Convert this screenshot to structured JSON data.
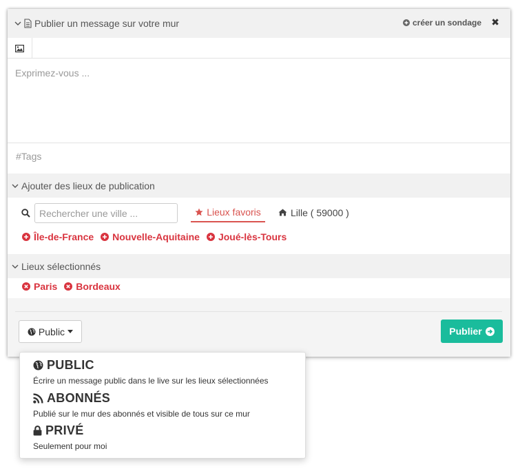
{
  "header": {
    "title": "Publier un message sur votre mur",
    "create_poll": "créer un sondage",
    "close": "✖"
  },
  "editor": {
    "placeholder": "Exprimez-vous ...",
    "tags_placeholder": "#Tags"
  },
  "places": {
    "section_title": "Ajouter des lieux de publication",
    "search_placeholder": "Rechercher une ville ...",
    "tab_favorites": "Lieux favoris",
    "tab_home": "Lille ( 59000 )",
    "suggestions": [
      "Île-de-France",
      "Nouvelle-Aquitaine",
      "Joué-lès-Tours"
    ]
  },
  "selected": {
    "section_title": "Lieux sélectionnés",
    "items": [
      "Paris",
      "Bordeaux"
    ]
  },
  "footer": {
    "visibility_button": "Public",
    "publish_button": "Publier"
  },
  "visibility_menu": {
    "options": [
      {
        "title": "PUBLIC",
        "desc": "Écrire un message public dans le live sur les lieux sélectionnées",
        "icon": "globe-icon"
      },
      {
        "title": "ABONNÉS",
        "desc": "Publié sur le mur des abonnés et visible de tous sur ce mur",
        "icon": "rss-icon"
      },
      {
        "title": "PRIVÉ",
        "desc": "Seulement pour moi",
        "icon": "lock-icon"
      }
    ]
  },
  "colors": {
    "accent_red": "#d9343f",
    "publish_green": "#1abc9c",
    "header_bg": "#f1f1f1"
  }
}
